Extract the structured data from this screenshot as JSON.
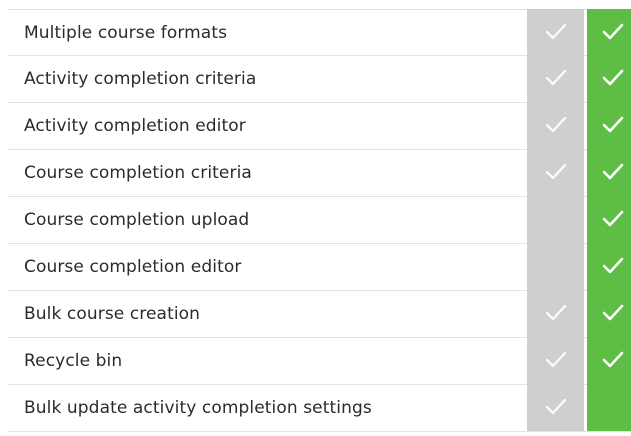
{
  "comparison_table": {
    "rows": [
      {
        "feature": "Multiple course formats",
        "column_a_check": true,
        "column_b_check": true
      },
      {
        "feature": "Activity completion criteria",
        "column_a_check": true,
        "column_b_check": true
      },
      {
        "feature": "Activity completion editor",
        "column_a_check": true,
        "column_b_check": true
      },
      {
        "feature": "Course completion criteria",
        "column_a_check": true,
        "column_b_check": true
      },
      {
        "feature": "Course completion upload",
        "column_a_check": false,
        "column_b_check": true
      },
      {
        "feature": "Course completion editor",
        "column_a_check": false,
        "column_b_check": true
      },
      {
        "feature": "Bulk course creation",
        "column_a_check": true,
        "column_b_check": true
      },
      {
        "feature": "Recycle bin",
        "column_a_check": true,
        "column_b_check": true
      },
      {
        "feature": "Bulk update activity completion settings",
        "column_a_check": true,
        "column_b_check": false
      }
    ],
    "colors": {
      "column_a_bg": "#cfcfd1",
      "column_b_bg": "#5ebd45",
      "check_color": "#ffffff",
      "text_color": "#2b2b2b"
    },
    "icon": "checkmark-icon"
  }
}
